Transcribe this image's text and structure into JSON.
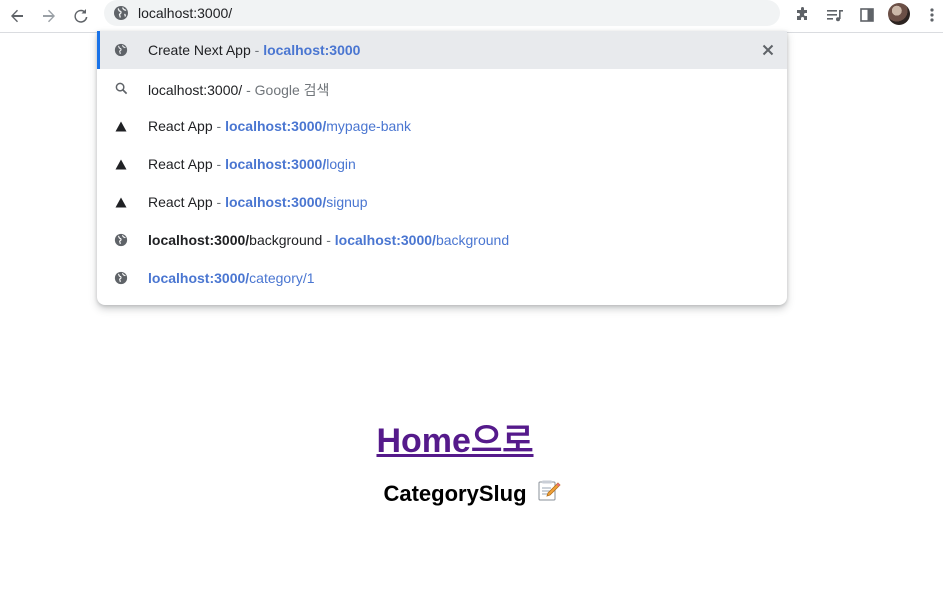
{
  "browser": {
    "url": "localhost:3000/",
    "icons": [
      "back-arrow-icon",
      "forward-arrow-icon",
      "reload-icon",
      "globe-icon",
      "extensions-icon",
      "media-queue-icon",
      "side-panel-icon",
      "more-vert-icon"
    ]
  },
  "suggestions": [
    {
      "title": "Create Next App",
      "sep": " - ",
      "url_bold": "localhost:3000",
      "url_rest": "",
      "icon": "globe-icon",
      "selected": true
    },
    {
      "title": "localhost:3000/",
      "sep": " - ",
      "extra": "Google 검색",
      "icon": "search-icon"
    },
    {
      "title": "React App",
      "sep": " - ",
      "url_bold": "localhost:3000/",
      "url_rest": "mypage-bank",
      "icon": "triangle-icon"
    },
    {
      "title": "React App",
      "sep": " - ",
      "url_bold": "localhost:3000/",
      "url_rest": "login",
      "icon": "triangle-icon"
    },
    {
      "title": "React App",
      "sep": " - ",
      "url_bold": "localhost:3000/",
      "url_rest": "signup",
      "icon": "triangle-icon"
    },
    {
      "title_bold": "localhost:3000/",
      "title_rest": "background",
      "sep": " - ",
      "url_bold": "localhost:3000/",
      "url_rest": "background",
      "icon": "globe-icon"
    },
    {
      "url_bold": "localhost:3000/",
      "url_rest": "category/1",
      "icon": "globe-icon"
    }
  ],
  "page": {
    "home_link": "Home으로",
    "heading": "CategorySlug"
  }
}
